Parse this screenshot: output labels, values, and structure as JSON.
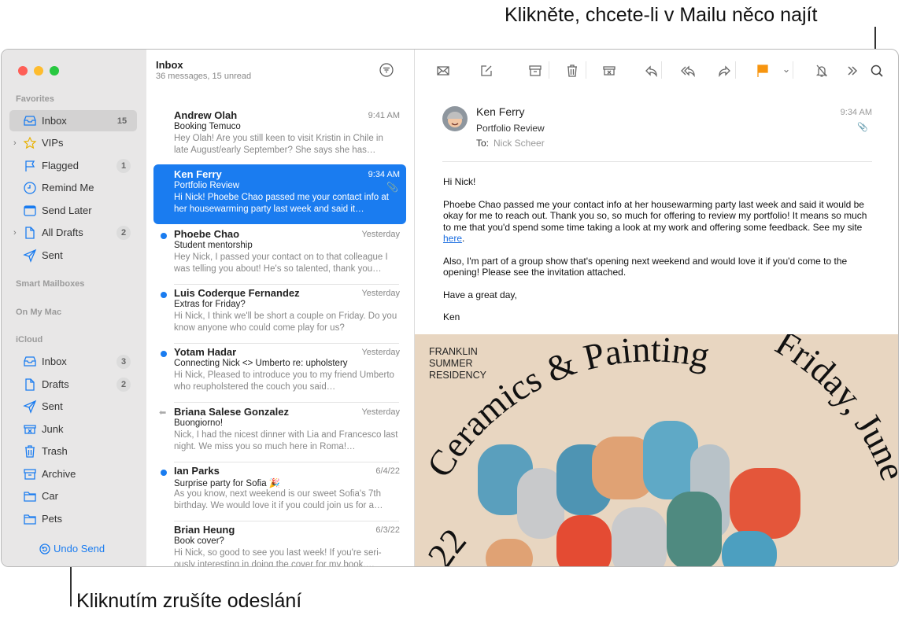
{
  "callouts": {
    "search": "Klikněte, chcete-li v Mailu něco najít",
    "undo": "Kliknutím zrušíte odeslání"
  },
  "colors": {
    "accent": "#1a7cf0",
    "flag": "#f7950f",
    "close": "#fe5f57",
    "minimize": "#febc2e",
    "zoom": "#28c840",
    "poster_bg": "#e8d6c1"
  },
  "sidebar": {
    "sections": [
      {
        "label": "Favorites",
        "items": [
          {
            "label": "Inbox",
            "icon": "inbox-icon",
            "count": "15",
            "selected": true
          },
          {
            "label": "VIPs",
            "icon": "star-icon",
            "expandable": true
          },
          {
            "label": "Flagged",
            "icon": "flag-icon",
            "count": "1"
          },
          {
            "label": "Remind Me",
            "icon": "clock-icon"
          },
          {
            "label": "Send Later",
            "icon": "calendar-icon"
          },
          {
            "label": "All Drafts",
            "icon": "document-icon",
            "count": "2",
            "expandable": true
          },
          {
            "label": "Sent",
            "icon": "paperplane-icon"
          }
        ]
      },
      {
        "label": "Smart Mailboxes",
        "items": []
      },
      {
        "label": "On My Mac",
        "items": []
      },
      {
        "label": "iCloud",
        "items": [
          {
            "label": "Inbox",
            "icon": "inbox-icon",
            "count": "3"
          },
          {
            "label": "Drafts",
            "icon": "document-icon",
            "count": "2"
          },
          {
            "label": "Sent",
            "icon": "paperplane-icon"
          },
          {
            "label": "Junk",
            "icon": "junk-icon"
          },
          {
            "label": "Trash",
            "icon": "trash-icon"
          },
          {
            "label": "Archive",
            "icon": "archive-icon"
          },
          {
            "label": "Car",
            "icon": "folder-icon"
          },
          {
            "label": "Pets",
            "icon": "folder-icon"
          }
        ]
      }
    ],
    "undo_send": "Undo Send"
  },
  "list": {
    "title": "Inbox",
    "subtitle": "36 messages, 15 unread",
    "messages": [
      {
        "name": "Andrew Olah",
        "time": "9:41 AM",
        "subject": "Booking Temuco",
        "preview": "Hey Olah! Are you still keen to visit Kristin in Chile in late August/early September? She says she has…"
      },
      {
        "name": "Ken Ferry",
        "time": "9:34 AM",
        "subject": "Portfolio Review",
        "preview": "Hi Nick! Phoebe Chao passed me your contact info at her housewarming party last week and said it…",
        "selected": true,
        "attachment": true
      },
      {
        "name": "Phoebe Chao",
        "time": "Yesterday",
        "subject": "Student mentorship",
        "preview": "Hey Nick, I passed your contact on to that colleague I was telling you about! He's so talented, thank you…",
        "unread": true
      },
      {
        "name": "Luis Coderque Fernandez",
        "time": "Yesterday",
        "subject": "Extras for Friday?",
        "preview": "Hi Nick, I think we'll be short a couple on Friday. Do you know anyone who could come play for us?",
        "unread": true
      },
      {
        "name": "Yotam Hadar",
        "time": "Yesterday",
        "subject": "Connecting Nick <> Umberto re: upholstery",
        "preview": "Hi Nick, Pleased to introduce you to my friend Umberto who reupholstered the couch you said…",
        "unread": true
      },
      {
        "name": "Briana Salese Gonzalez",
        "time": "Yesterday",
        "subject": "Buongiorno!",
        "preview": "Nick, I had the nicest dinner with Lia and Francesco last night. We miss you so much here in Roma!…",
        "replied": true
      },
      {
        "name": "Ian Parks",
        "time": "6/4/22",
        "subject": "Surprise party for Sofia 🎉",
        "preview": "As you know, next weekend is our sweet Sofia's 7th birthday. We would love it if you could join us for a…",
        "unread": true
      },
      {
        "name": "Brian Heung",
        "time": "6/3/22",
        "subject": "Book cover?",
        "preview": "Hi Nick, so good to see you last week! If you're seri-ously interesting in doing the cover for my book,…"
      }
    ]
  },
  "toolbar": [
    "envelope-icon",
    "compose-icon",
    "archive-icon",
    "trash-icon",
    "junk-icon",
    "reply-icon",
    "reply-all-icon",
    "forward-icon",
    "flag-icon",
    "chevron-down-icon",
    "bell-slash-icon",
    "more-icon",
    "search-icon"
  ],
  "message": {
    "from": "Ken Ferry",
    "subject": "Portfolio Review",
    "to_label": "To:",
    "to": "Nick Scheer",
    "time": "9:34 AM",
    "greeting": "Hi Nick!",
    "p1": "Phoebe Chao passed me your contact info at her housewarming party last week and said it would be okay for me to reach out. Thank you so, so much for offering to review my portfolio! It means so much to me that you'd spend some time taking a look at my work and offering some feedback. See my site ",
    "link": "here",
    "p1_end": ".",
    "p2": "Also, I'm part of a group show that's opening next weekend and would love it if you'd come to the opening! Please see the invitation attached.",
    "p3": "Have a great day,",
    "signature": "Ken"
  },
  "poster": {
    "tag": [
      "FRANKLIN",
      "SUMMER",
      "RESIDENCY"
    ],
    "arc_title": "Ceramics & Painting",
    "arc_date": "Friday, June",
    "arc_day": "22"
  }
}
